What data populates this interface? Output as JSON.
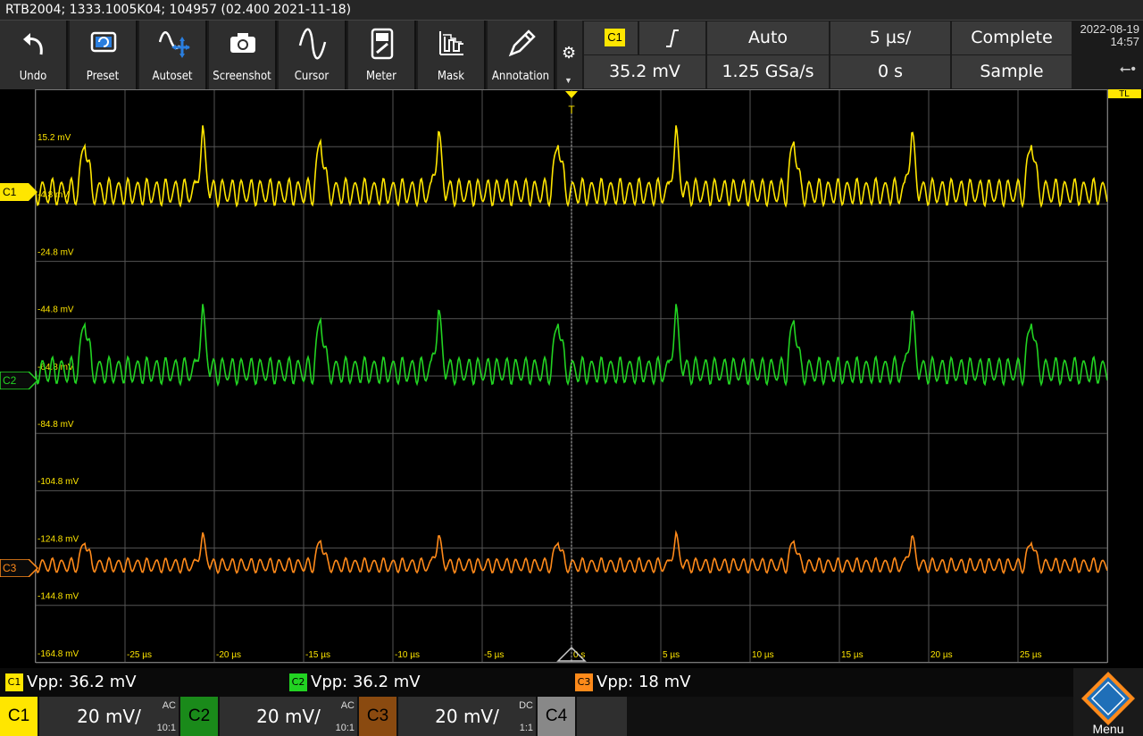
{
  "title": "RTB2004; 1333.1005K04; 104957 (02.400 2021-11-18)",
  "toolbar": [
    {
      "label": "Undo",
      "icon": "undo-icon"
    },
    {
      "label": "Preset",
      "icon": "preset-icon"
    },
    {
      "label": "Autoset",
      "icon": "autoset-icon"
    },
    {
      "label": "Screenshot",
      "icon": "camera-icon"
    },
    {
      "label": "Cursor",
      "icon": "cursor-icon"
    },
    {
      "label": "Meter",
      "icon": "meter-icon"
    },
    {
      "label": "Mask",
      "icon": "mask-icon"
    },
    {
      "label": "Annotation",
      "icon": "pen-icon"
    }
  ],
  "trigger": {
    "source": "C1",
    "slope_icon": "rising-edge-icon",
    "level": "35.2 mV",
    "mode": "Auto",
    "sample_rate": "1.25 GSa/s"
  },
  "timebase": {
    "scale": "5 µs/",
    "position": "0 s"
  },
  "acquisition": {
    "state": "Complete",
    "mode": "Sample"
  },
  "datetime": {
    "date": "2022-08-19",
    "time": "14:57"
  },
  "markers": {
    "c1": "C1",
    "c2": "C2",
    "c3": "C3",
    "tl": "TL",
    "t": "T"
  },
  "y_labels": [
    "15.2 mV",
    "-4.8 mV",
    "-24.8 mV",
    "-44.8 mV",
    "-64.8 mV",
    "-84.8 mV",
    "-104.8 mV",
    "-124.8 mV",
    "-144.8 mV",
    "-164.8 mV"
  ],
  "x_labels": [
    "-25 µs",
    "-20 µs",
    "-15 µs",
    "-10 µs",
    "-5 µs",
    "0 s",
    "5 µs",
    "10 µs",
    "15 µs",
    "20 µs",
    "25 µs"
  ],
  "measurements": [
    {
      "tag": "C1",
      "text": "Vpp: 36.2 mV"
    },
    {
      "tag": "C2",
      "text": "Vpp: 36.2 mV"
    },
    {
      "tag": "C3",
      "text": "Vpp: 18 mV"
    }
  ],
  "channels": [
    {
      "name": "C1",
      "scale": "20 mV/",
      "coupling": "AC",
      "probe": "10:1"
    },
    {
      "name": "C2",
      "scale": "20 mV/",
      "coupling": "AC",
      "probe": "10:1"
    },
    {
      "name": "C3",
      "scale": "20 mV/",
      "coupling": "DC",
      "probe": "1:1"
    },
    {
      "name": "C4"
    }
  ],
  "menu_label": "Menu",
  "colors": {
    "c1": "#ffe600",
    "c2": "#22d322",
    "c3": "#ff8a1a",
    "c4": "#888888",
    "grid": "#555555"
  }
}
